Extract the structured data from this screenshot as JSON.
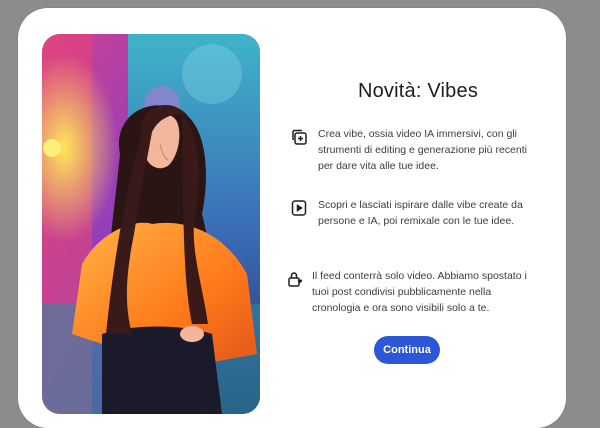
{
  "dialog": {
    "title": "Novità: Vibes",
    "hero_image": "woman-in-orange-jacket-neon-illustration",
    "features": [
      {
        "icon": "add-video-icon",
        "text": "Crea vibe, ossia video IA immersivi, con gli strumenti di editing e generazione più recenti per dare vita alle tue idee."
      },
      {
        "icon": "play-video-icon",
        "text": "Scopri e lasciati ispirare dalle vibe create da persone e IA, poi remixale con le tue idee."
      },
      {
        "icon": "lock-heart-icon",
        "text": "Il feed conterrà solo video. Abbiamo spostato i tuoi post condivisi pubblicamente nella cronologia e ora sono visibili solo a te."
      }
    ],
    "continue_label": "Continua"
  },
  "colors": {
    "overlay": "#8c8c8c",
    "modal": "#ffffff",
    "button": "#2d57d6",
    "title": "#1c1e21",
    "body_text": "#3a3d42"
  }
}
